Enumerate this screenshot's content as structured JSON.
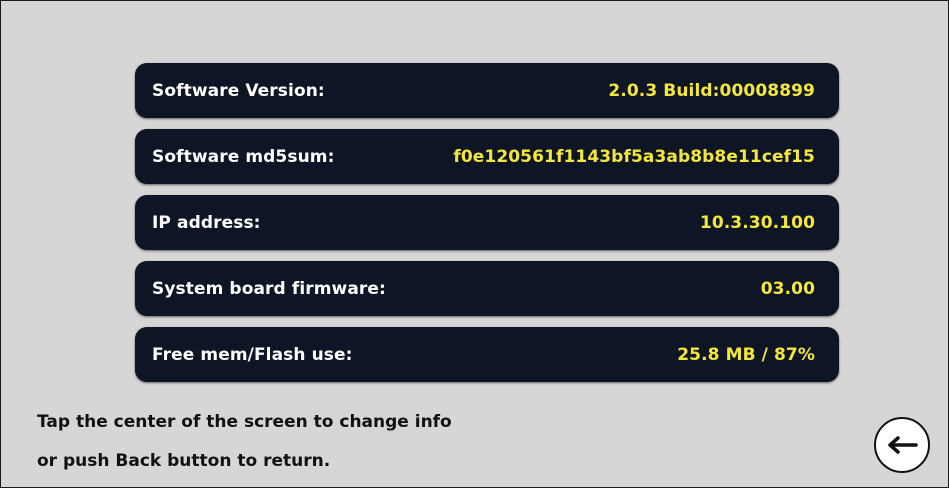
{
  "info_rows": [
    {
      "label": "Software Version:",
      "value": "2.0.3 Build:00008899"
    },
    {
      "label": "Software md5sum:",
      "value": "f0e120561f1143bf5a3ab8b8e11cef15"
    },
    {
      "label": "IP address:",
      "value": "10.3.30.100"
    },
    {
      "label": "System board firmware:",
      "value": "03.00"
    },
    {
      "label": "Free mem/Flash use:",
      "value": "25.8 MB / 87%"
    }
  ],
  "instructions": {
    "line1": "Tap the center of the screen to change info",
    "line2": "or push Back button to return."
  },
  "back_button": {
    "icon": "arrow-left-icon"
  },
  "colors": {
    "background": "#d6d6d6",
    "row_background": "#0e1524",
    "label_text": "#ffffff",
    "value_text": "#f4e63a",
    "instruction_text": "#111111"
  }
}
